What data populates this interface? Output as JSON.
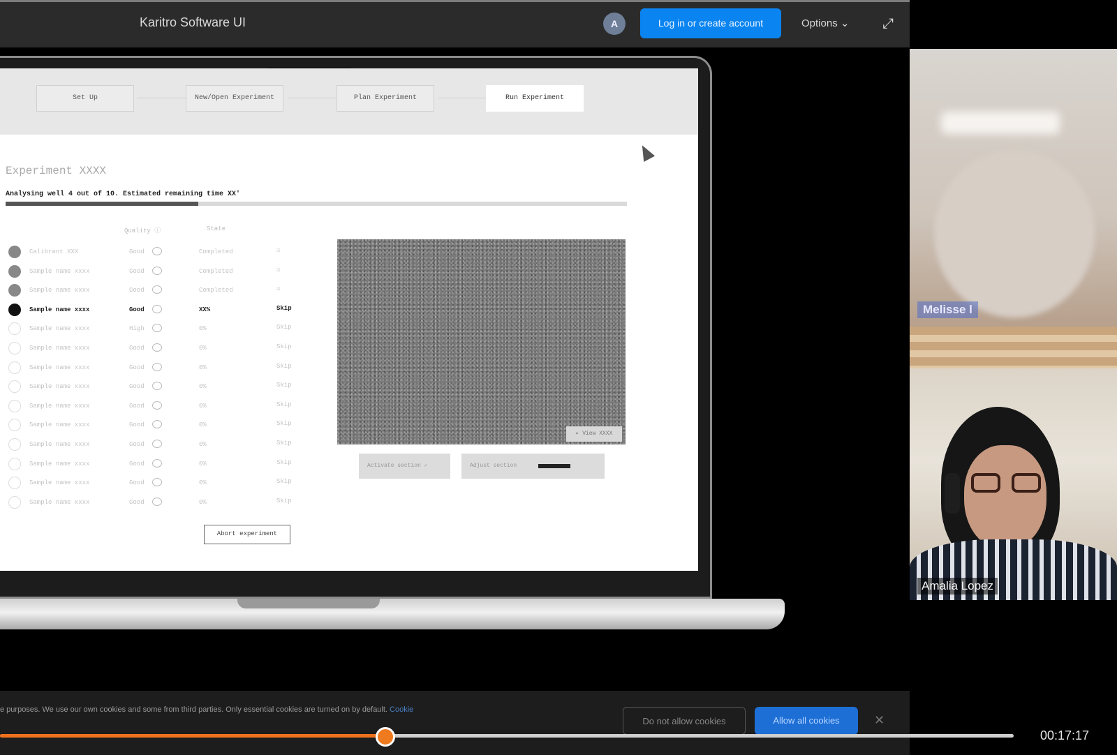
{
  "topbar": {
    "app_title": "Karitro Software UI",
    "avatar_letter": "A",
    "login_label": "Log in or create account",
    "options_label": "Options ⌄",
    "expand_icon": "expand-icon"
  },
  "screen": {
    "steps": [
      "Set Up",
      "New/Open Experiment",
      "Plan Experiment",
      "Run Experiment"
    ],
    "active_step": 3,
    "experiment_title": "Experiment XXXX",
    "progress_text": "Analysing well 4 out of 10. Estimated remaining time XX'",
    "progress_percent": 31,
    "col_quality": "Quality ⓘ",
    "col_state": "State",
    "samples": [
      {
        "name": "Calibrant XXX",
        "quality": "Good",
        "state": "Completed",
        "action": "☑",
        "status": "done"
      },
      {
        "name": "Sample name xxxx",
        "quality": "Good",
        "state": "Completed",
        "action": "☑",
        "status": "done"
      },
      {
        "name": "Sample name xxxx",
        "quality": "Good",
        "state": "Completed",
        "action": "☑",
        "status": "done"
      },
      {
        "name": "Sample name xxxx",
        "quality": "Good",
        "state": "XX%",
        "action": "Skip",
        "status": "current"
      },
      {
        "name": "Sample name xxxx",
        "quality": "High",
        "state": "0%",
        "action": "Skip",
        "status": "pending"
      },
      {
        "name": "Sample name xxxx",
        "quality": "Good",
        "state": "0%",
        "action": "Skip",
        "status": "pending"
      },
      {
        "name": "Sample name xxxx",
        "quality": "Good",
        "state": "0%",
        "action": "Skip",
        "status": "pending"
      },
      {
        "name": "Sample name xxxx",
        "quality": "Good",
        "state": "0%",
        "action": "Skip",
        "status": "pending"
      },
      {
        "name": "Sample name xxxx",
        "quality": "Good",
        "state": "0%",
        "action": "Skip",
        "status": "pending"
      },
      {
        "name": "Sample name xxxx",
        "quality": "Good",
        "state": "0%",
        "action": "Skip",
        "status": "pending"
      },
      {
        "name": "Sample name xxxx",
        "quality": "Good",
        "state": "0%",
        "action": "Skip",
        "status": "pending"
      },
      {
        "name": "Sample name xxxx",
        "quality": "Good",
        "state": "0%",
        "action": "Skip",
        "status": "pending"
      },
      {
        "name": "Sample name xxxx",
        "quality": "Good",
        "state": "0%",
        "action": "Skip",
        "status": "pending"
      },
      {
        "name": "Sample name xxxx",
        "quality": "Good",
        "state": "0%",
        "action": "Skip",
        "status": "pending"
      }
    ],
    "abort_label": "Abort experiment",
    "view_label": "▸ View XXXX",
    "button_a_label": "Activate section ✓",
    "button_b_label": "Adjust section"
  },
  "participants": {
    "tile1_name": "Melisse l",
    "tile2_name": "Amalia Lopez"
  },
  "cookie": {
    "text": "e purposes. We use our own cookies and some from third parties. Only essential cookies are turned on by default.",
    "link": "Cookie",
    "deny_label": "Do not allow cookies",
    "allow_label": "Allow all cookies",
    "close": "✕"
  },
  "player": {
    "time": "00:17:17",
    "progress": 0.38,
    "accent": "#f0711b"
  }
}
